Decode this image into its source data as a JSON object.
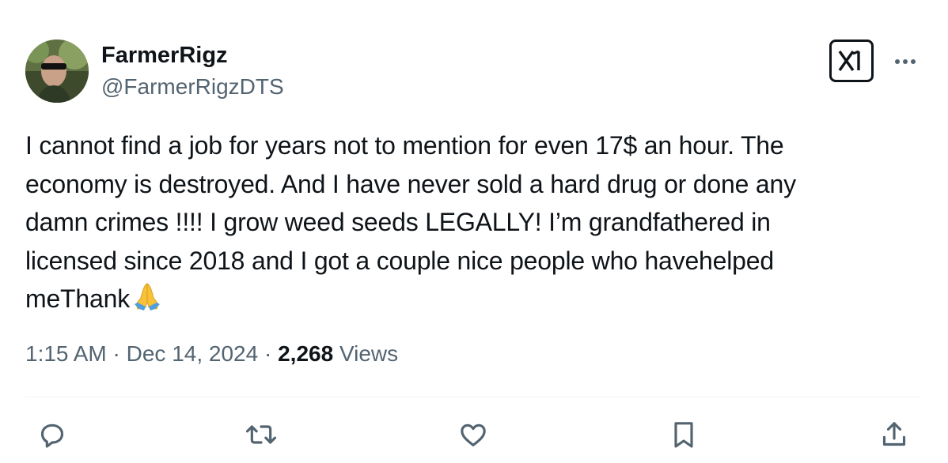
{
  "author": {
    "name": "FarmerRigz",
    "handle": "@FarmerRigzDTS"
  },
  "tweet": {
    "lines": [
      "I cannot find a job for years not to mention for even 17$ an hour. The",
      "economy is destroyed. And I have never sold a hard drug or done any",
      "damn crimes !!!! I grow weed seeds LEGALLY! I’m grandfathered in",
      "licensed since 2018 and I got a couple nice people who havehelped",
      "meThank"
    ],
    "emoji": "folded-hands"
  },
  "meta": {
    "time": "1:15 AM",
    "separator1": " · ",
    "date": "Dec 14, 2024",
    "separator2": " · ",
    "views_count": "2,268",
    "views_label": " Views"
  },
  "actions": [
    {
      "name": "reply",
      "icon": "reply-icon"
    },
    {
      "name": "retweet",
      "icon": "retweet-icon"
    },
    {
      "name": "like",
      "icon": "heart-icon"
    },
    {
      "name": "bookmark",
      "icon": "bookmark-icon"
    },
    {
      "name": "share",
      "icon": "share-icon"
    }
  ],
  "colors": {
    "text": "#0f1419",
    "secondary": "#536471",
    "divider": "#eff3f4"
  }
}
